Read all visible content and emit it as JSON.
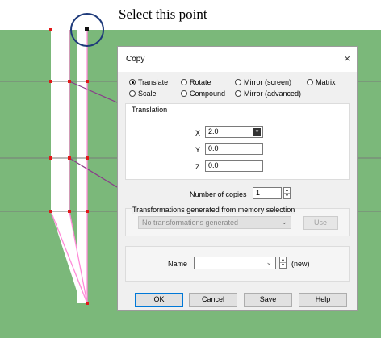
{
  "annotation": "Select this point",
  "colors": {
    "background": "#7bb87a",
    "pink_line": "#ff8bd8",
    "point": "#e11919",
    "highlight_circle": "#1e3a7a",
    "dialog_bg": "#f0f0f0",
    "accent": "#0078d7"
  },
  "dialog": {
    "title": "Copy",
    "close_icon": "×",
    "modes": [
      {
        "label": "Translate",
        "selected": true
      },
      {
        "label": "Rotate",
        "selected": false
      },
      {
        "label": "Mirror (screen)",
        "selected": false
      },
      {
        "label": "Matrix",
        "selected": false
      },
      {
        "label": "Scale",
        "selected": false
      },
      {
        "label": "Compound",
        "selected": false
      },
      {
        "label": "Mirror (advanced)",
        "selected": false
      }
    ],
    "translation": {
      "label": "Translation",
      "x_label": "X",
      "x_value": "2.0",
      "y_label": "Y",
      "y_value": "0.0",
      "z_label": "Z",
      "z_value": "0.0"
    },
    "copies": {
      "label": "Number of copies",
      "value": "1"
    },
    "memory": {
      "label": "Transformations generated from memory selection",
      "selected": "No transformations generated",
      "use_label": "Use"
    },
    "name": {
      "label": "Name",
      "value": "",
      "suffix": "(new)"
    },
    "buttons": {
      "ok": "OK",
      "cancel": "Cancel",
      "save": "Save",
      "help": "Help"
    }
  }
}
